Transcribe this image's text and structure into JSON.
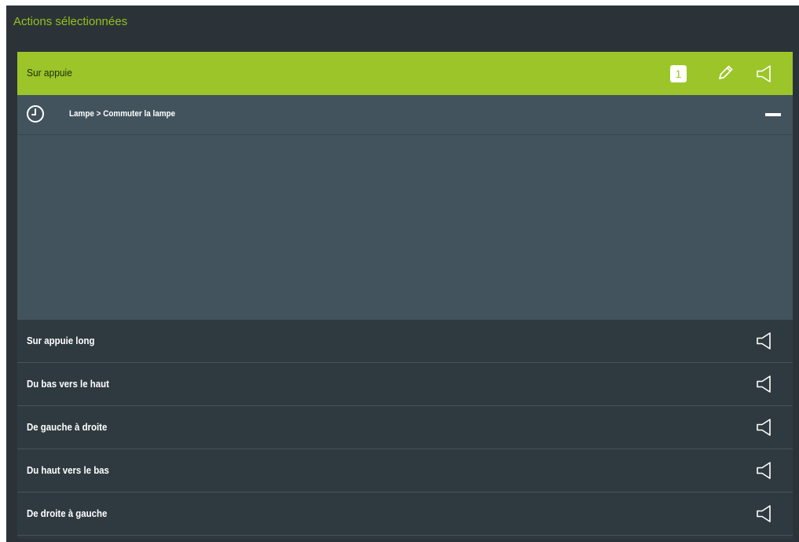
{
  "title": "Actions sélectionnées",
  "active_trigger": {
    "label": "Sur appuie",
    "count": "1",
    "action_text": "Lampe > Commuter la lampe"
  },
  "triggers": [
    {
      "label": "Sur appuie long"
    },
    {
      "label": "Du bas vers le haut"
    },
    {
      "label": "De gauche à droite"
    },
    {
      "label": "Du haut vers le bas"
    },
    {
      "label": "De droite à gauche"
    }
  ],
  "colors": {
    "accent": "#9bc528",
    "background": "#2b3338",
    "row_background": "#2f3a40",
    "expanded_background": "#42535d"
  },
  "icons": {
    "edit": "pencil-icon",
    "sound": "speaker-icon",
    "timer": "clock-icon",
    "collapse": "minus-icon"
  }
}
